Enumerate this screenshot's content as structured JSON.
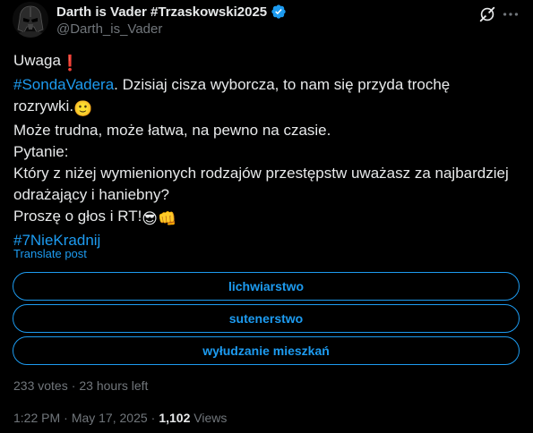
{
  "author": {
    "display_name": "Darth is Vader #Trzaskowski2025",
    "handle": "@Darth_is_Vader",
    "verified_icon": "verified-badge-icon",
    "avatar_icon": "darth-vader-helmet-avatar"
  },
  "header_actions": {
    "grok_icon": "grok-icon",
    "more_icon": "more-options-icon"
  },
  "post": {
    "line1": "Uwaga",
    "line1_emoji": "❗",
    "hashtag1": "#SondaVadera",
    "line2_rest": ". Dzisiaj cisza wyborcza, to nam się przyda trochę",
    "line3": "rozrywki.",
    "line3_emoji": "🙂",
    "line4": "Może trudna, może łatwa, na pewno na czasie.",
    "line5": "Pytanie:",
    "line6": "Który z niżej wymienionych rodzajów przestępstw uważasz za najbardziej",
    "line7": "odrażający i haniebny?",
    "line8": "Proszę o głos i RT!",
    "line8_emoji1": "😎",
    "line8_emoji2": "👊",
    "hashtag2": "#7NieKradnij",
    "translate_label": "Translate post"
  },
  "poll": {
    "options": [
      {
        "label": "lichwiarstwo"
      },
      {
        "label": "sutenerstwo"
      },
      {
        "label": "wyłudzanie mieszkań"
      }
    ],
    "votes": "233 votes",
    "separator": "·",
    "time_left": "23 hours left"
  },
  "footer": {
    "time": "1:22 PM",
    "separator": "·",
    "date": "May 17, 2025",
    "views_count": "1,102",
    "views_label": "Views"
  },
  "colors": {
    "background": "#000000",
    "text": "#e7e9ea",
    "muted": "#71767b",
    "accent": "#1d9bf0"
  }
}
